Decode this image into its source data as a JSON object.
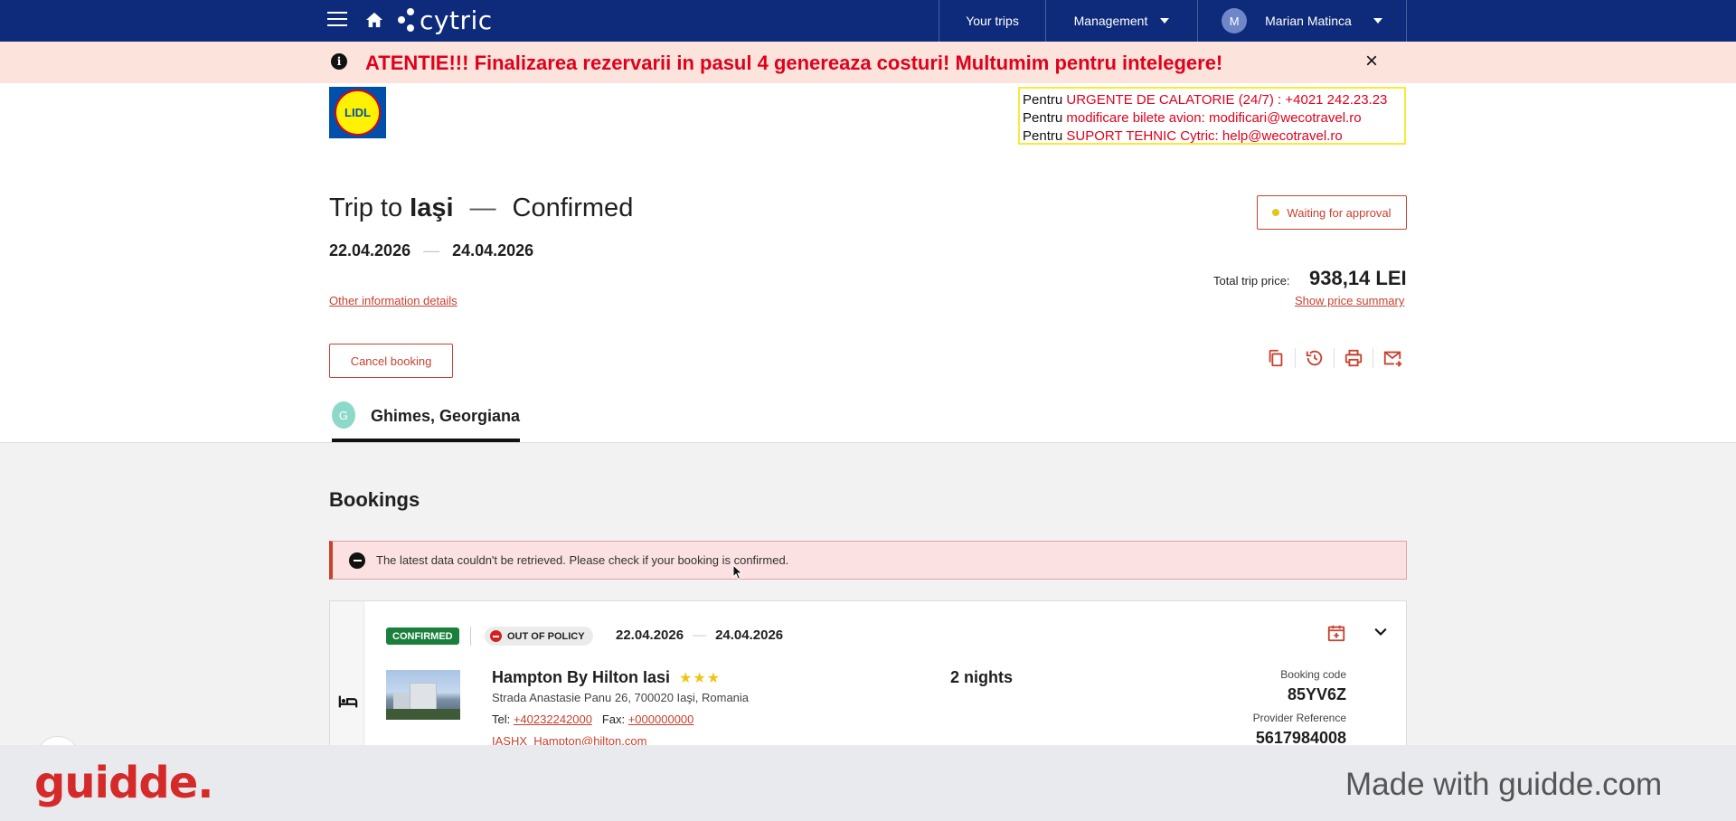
{
  "nav": {
    "logo_text": "cytric",
    "your_trips": "Your trips",
    "management": "Management",
    "user_initial": "M",
    "user_name": "Marian Matinca"
  },
  "banner": {
    "text": "ATENTIE!!! Finalizarea rezervarii in pasul 4 genereaza costuri! Multumim pentru intelegere!",
    "close": "×"
  },
  "company": {
    "logo_text": "LIDL",
    "contacts": [
      {
        "prefix": "Pentru ",
        "text": "URGENTE DE CALATORIE (24/7) : +4021 242.23.23"
      },
      {
        "prefix": "Pentru ",
        "text": "modificare bilete avion:  modificari@wecotravel.ro"
      },
      {
        "prefix": "Pentru ",
        "text": "SUPORT TEHNIC Cytric:  help@wecotravel.ro"
      }
    ]
  },
  "trip": {
    "title_prefix": "Trip to ",
    "destination": "Iaşi",
    "dash": "—",
    "status_text": "Confirmed",
    "start_date": "22.04.2026",
    "end_date": "24.04.2026",
    "date_sep": "—",
    "other_info": "Other information details",
    "approval_status": "Waiting for approval",
    "total_label": "Total trip price:",
    "total_value": "938,14 LEI",
    "show_price_summary": "Show price summary",
    "cancel_button": "Cancel booking"
  },
  "traveler": {
    "initial": "G",
    "name": "Ghimes, Georgiana"
  },
  "bookings": {
    "title": "Bookings",
    "error_message": "The latest data couldn't be retrieved. Please check if your booking is confirmed.",
    "hotel": {
      "status_badge": "CONFIRMED",
      "policy_badge": "OUT OF POLICY",
      "check_in": "22.04.2026",
      "check_out": "24.04.2026",
      "date_sep": "—",
      "name": "Hampton By Hilton Iasi",
      "stars": 3,
      "stars_text": "★★★",
      "address": "Strada Anastasie Panu 26, 700020 Iaşi, Romania",
      "tel_label": "Tel: ",
      "tel": "+40232242000",
      "fax_label": "Fax: ",
      "fax": "+000000000",
      "email": "IASHX_Hampton@hilton.com",
      "nights": "2 nights",
      "booking_code_label": "Booking code",
      "booking_code": "85YV6Z",
      "provider_ref_label": "Provider Reference",
      "provider_ref": "5617984008"
    }
  },
  "footer": {
    "brand": "guidde.",
    "made_with": "Made with guidde.com"
  },
  "colors": {
    "nav_bg": "#0e2a7a",
    "accent_red": "#c8412f",
    "alert_red": "#e0001b",
    "confirmed_green": "#1a7f3c"
  }
}
